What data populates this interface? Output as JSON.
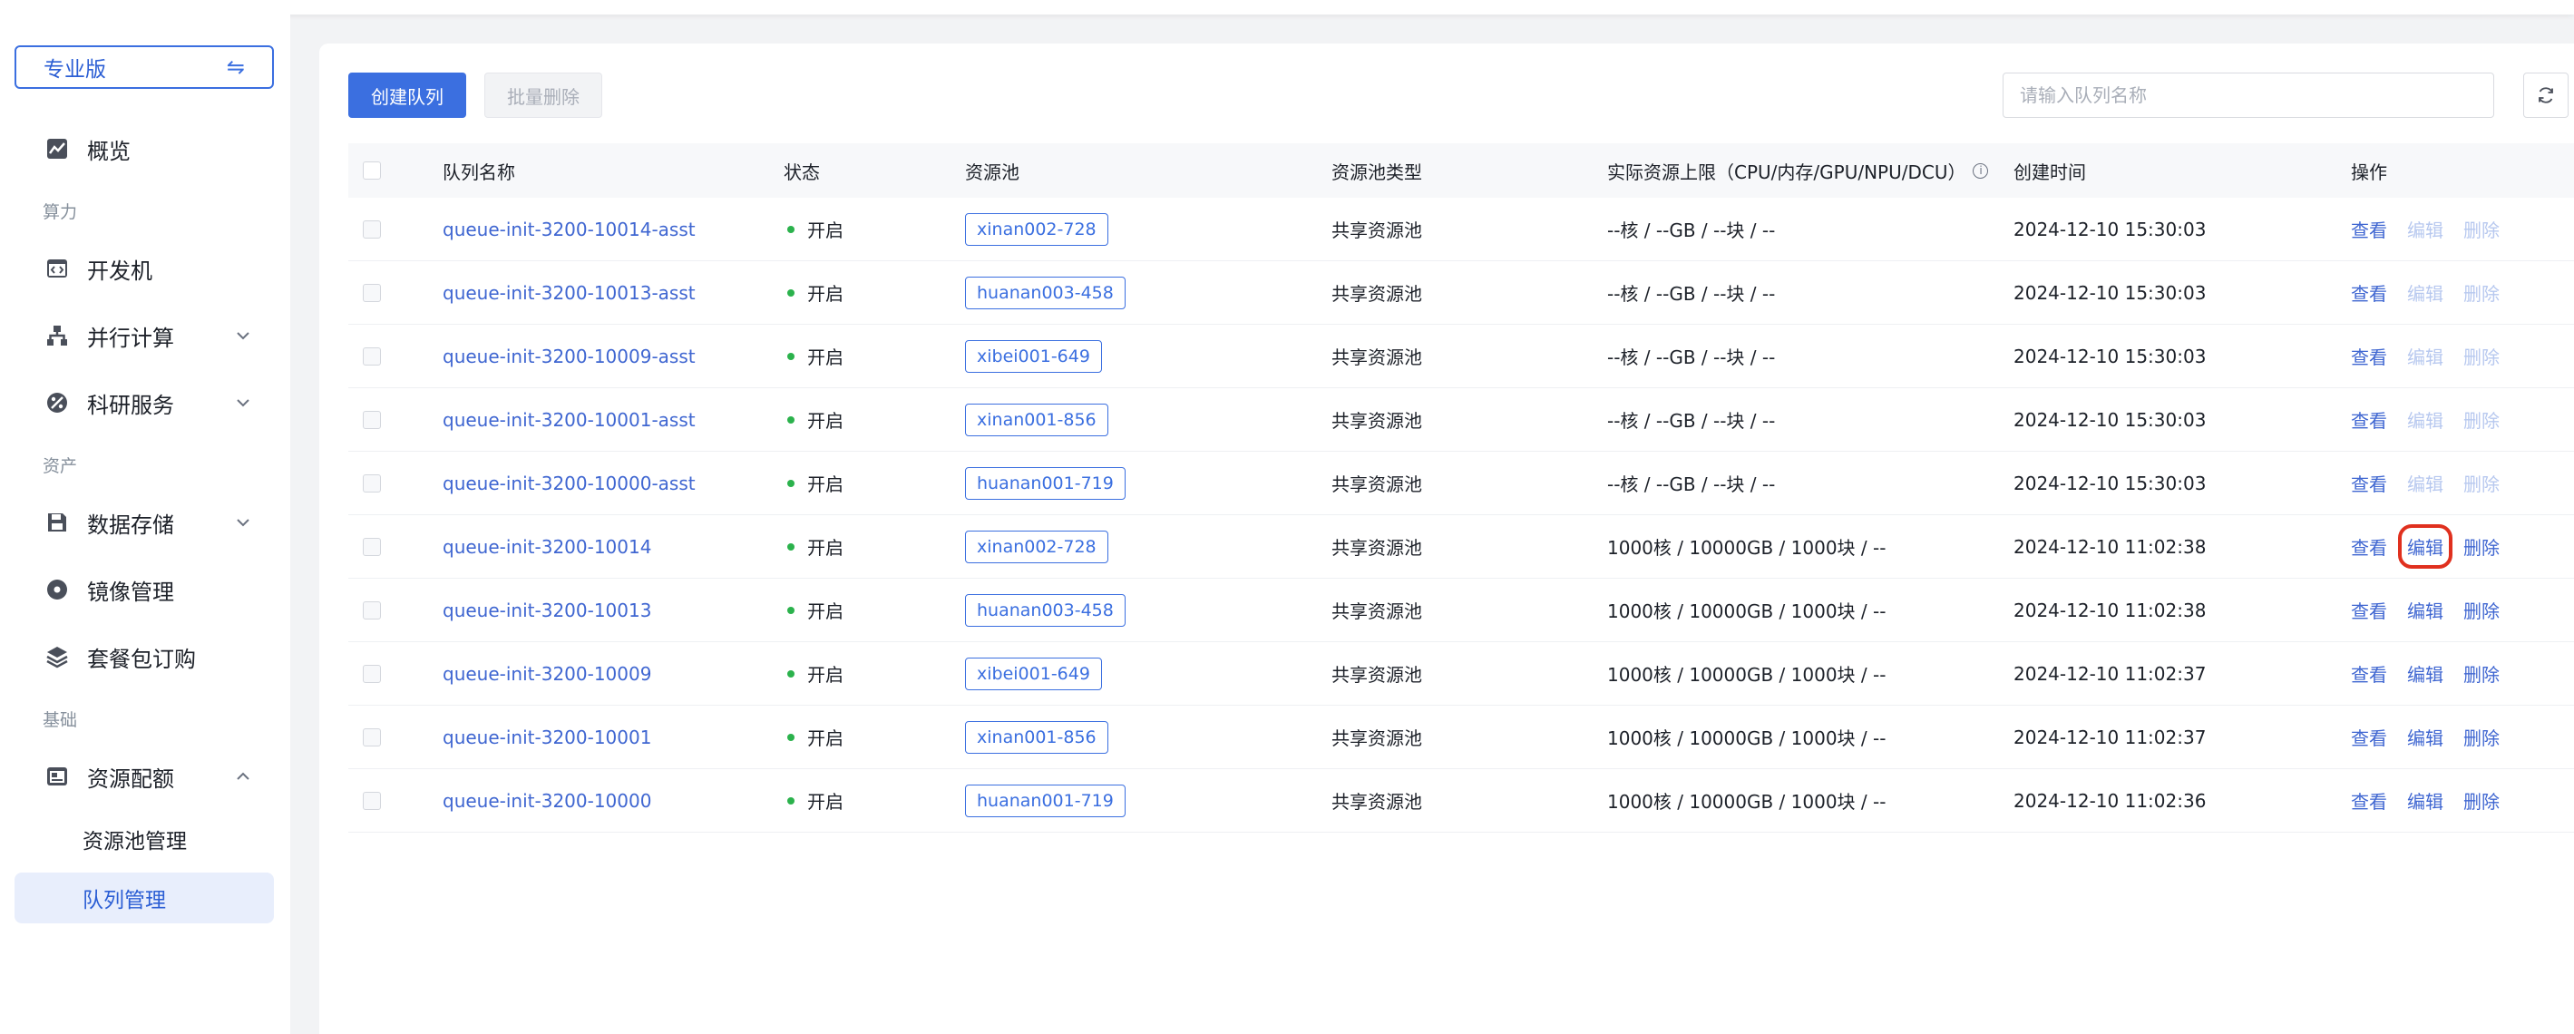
{
  "sidebar": {
    "edition": "专业版",
    "items": {
      "overview": "概览",
      "group_compute": "算力",
      "devbox": "开发机",
      "parallel": "并行计算",
      "research": "科研服务",
      "group_assets": "资产",
      "storage": "数据存储",
      "images": "镜像管理",
      "packages": "套餐包订购",
      "group_basic": "基础",
      "quota": "资源配额",
      "pool_mgmt": "资源池管理",
      "queue_mgmt": "队列管理"
    },
    "active_item": "队列管理"
  },
  "toolbar": {
    "create_label": "创建队列",
    "batch_delete_label": "批量删除",
    "search_placeholder": "请输入队列名称",
    "search_value": ""
  },
  "table": {
    "headers": {
      "name": "队列名称",
      "status": "状态",
      "pool": "资源池",
      "pool_type": "资源池类型",
      "limit": "实际资源上限（CPU/内存/GPU/NPU/DCU）",
      "created": "创建时间",
      "actions": "操作"
    },
    "action_labels": {
      "view": "查看",
      "edit": "编辑",
      "delete": "删除"
    },
    "rows": [
      {
        "name": "queue-init-3200-10014-asst",
        "status": "开启",
        "pool": "xinan002-728",
        "pool_type": "共享资源池",
        "limit": "--核 / --GB / --块 / --",
        "created": "2024-12-10 15:30:03",
        "editable": false
      },
      {
        "name": "queue-init-3200-10013-asst",
        "status": "开启",
        "pool": "huanan003-458",
        "pool_type": "共享资源池",
        "limit": "--核 / --GB / --块 / --",
        "created": "2024-12-10 15:30:03",
        "editable": false
      },
      {
        "name": "queue-init-3200-10009-asst",
        "status": "开启",
        "pool": "xibei001-649",
        "pool_type": "共享资源池",
        "limit": "--核 / --GB / --块 / --",
        "created": "2024-12-10 15:30:03",
        "editable": false
      },
      {
        "name": "queue-init-3200-10001-asst",
        "status": "开启",
        "pool": "xinan001-856",
        "pool_type": "共享资源池",
        "limit": "--核 / --GB / --块 / --",
        "created": "2024-12-10 15:30:03",
        "editable": false
      },
      {
        "name": "queue-init-3200-10000-asst",
        "status": "开启",
        "pool": "huanan001-719",
        "pool_type": "共享资源池",
        "limit": "--核 / --GB / --块 / --",
        "created": "2024-12-10 15:30:03",
        "editable": false
      },
      {
        "name": "queue-init-3200-10014",
        "status": "开启",
        "pool": "xinan002-728",
        "pool_type": "共享资源池",
        "limit": "1000核 / 10000GB / 1000块 / --",
        "created": "2024-12-10 11:02:38",
        "editable": true,
        "highlight_edit": true
      },
      {
        "name": "queue-init-3200-10013",
        "status": "开启",
        "pool": "huanan003-458",
        "pool_type": "共享资源池",
        "limit": "1000核 / 10000GB / 1000块 / --",
        "created": "2024-12-10 11:02:38",
        "editable": true
      },
      {
        "name": "queue-init-3200-10009",
        "status": "开启",
        "pool": "xibei001-649",
        "pool_type": "共享资源池",
        "limit": "1000核 / 10000GB / 1000块 / --",
        "created": "2024-12-10 11:02:37",
        "editable": true
      },
      {
        "name": "queue-init-3200-10001",
        "status": "开启",
        "pool": "xinan001-856",
        "pool_type": "共享资源池",
        "limit": "1000核 / 10000GB / 1000块 / --",
        "created": "2024-12-10 11:02:37",
        "editable": true
      },
      {
        "name": "queue-init-3200-10000",
        "status": "开启",
        "pool": "huanan001-719",
        "pool_type": "共享资源池",
        "limit": "1000核 / 10000GB / 1000块 / --",
        "created": "2024-12-10 11:02:36",
        "editable": true
      }
    ]
  },
  "colors": {
    "accent": "#3b6fe0",
    "link": "#3f66d1",
    "status_on": "#2bb24c",
    "highlight": "#e0301e"
  }
}
